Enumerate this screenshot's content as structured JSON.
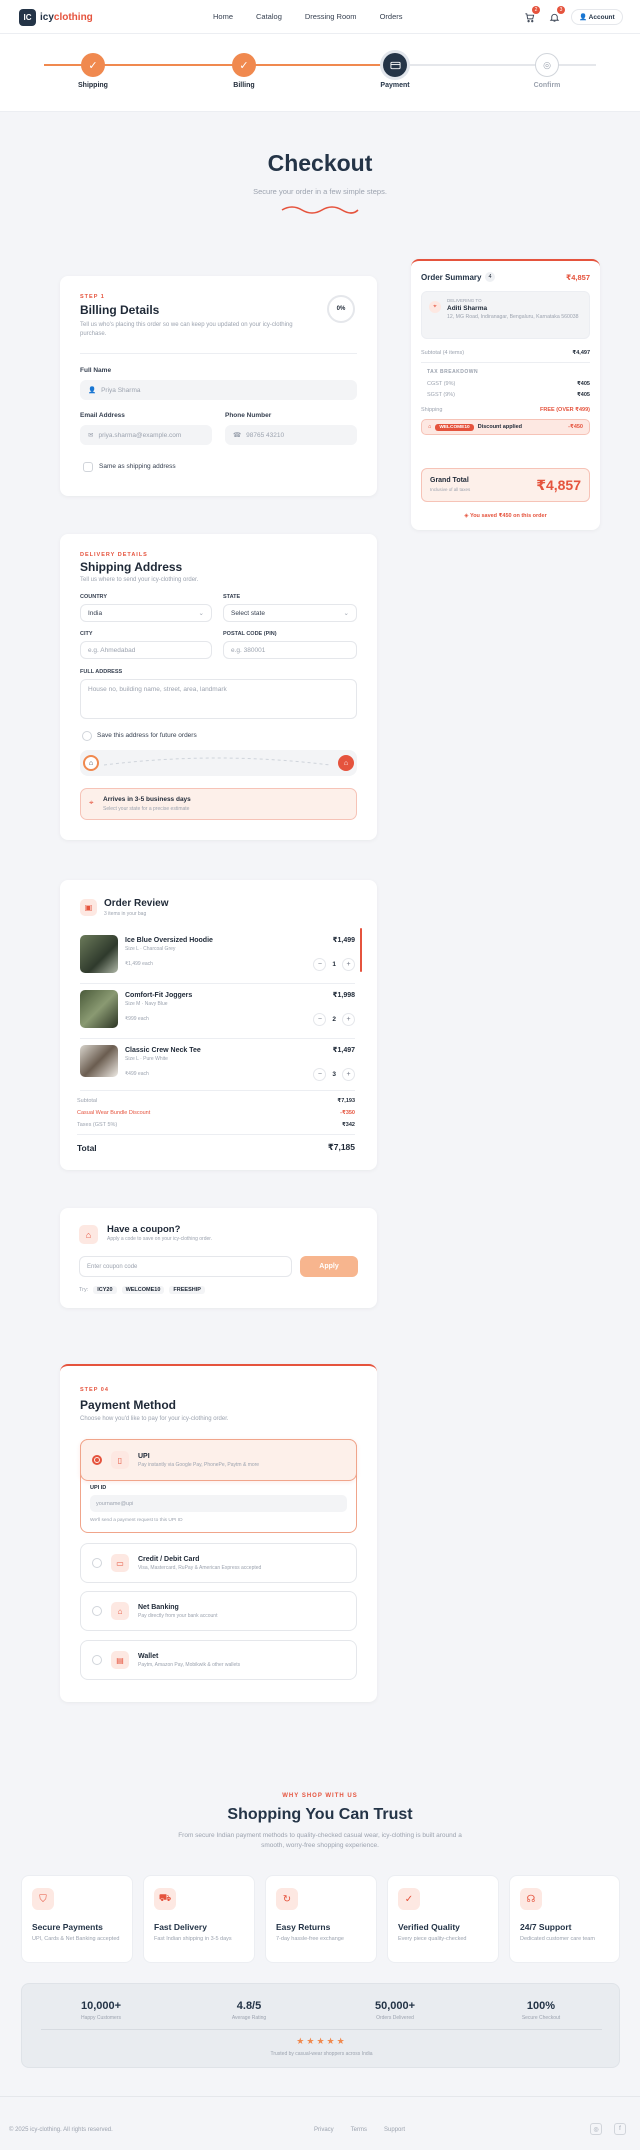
{
  "header": {
    "logo_mark": "IC",
    "brand_a": "icy",
    "brand_b": "clothing",
    "nav": [
      "Home",
      "Catalog",
      "Dressing Room",
      "Orders"
    ],
    "cart_count": "2",
    "notif_count": "3",
    "account_label": "Account"
  },
  "stepper": {
    "steps": [
      "Shipping",
      "Billing",
      "Payment",
      "Confirm"
    ]
  },
  "page": {
    "title": "Checkout",
    "subtitle": "Secure your order in a few simple steps."
  },
  "billing": {
    "eyebrow": "STEP 1",
    "title": "Billing Details",
    "subtitle": "Tell us who's placing this order so we can keep you updated on your icy-clothing purchase.",
    "progress": "0%",
    "progress_value": 0,
    "full_name_label": "Full Name",
    "full_name_placeholder": "Priya Sharma",
    "email_label": "Email Address",
    "email_placeholder": "priya.sharma@example.com",
    "phone_label": "Phone Number",
    "phone_placeholder": "98765 43210",
    "same_as_shipping": "Same as shipping address"
  },
  "summary": {
    "title": "Order Summary",
    "count": "4",
    "total_top": "₹4,857",
    "deliver_to_label": "DELIVERING TO",
    "name": "Aditi Sharma",
    "address": "12, MG Road, Indiranagar, Bengaluru, Karnataka 560038",
    "subtotal_label": "Subtotal (4 items)",
    "subtotal": "₹4,497",
    "tax_label": "TAX BREAKDOWN",
    "cgst_label": "CGST (9%)",
    "cgst": "₹405",
    "sgst_label": "SGST (9%)",
    "sgst": "₹405",
    "shipping_label": "Shipping",
    "shipping_value": "FREE (OVER ₹499)",
    "coupon_code": "WELCOME10",
    "discount_label": "Discount applied",
    "discount_value": "-₹450",
    "grand_label": "Grand Total",
    "grand_sub": "Inclusive of all taxes",
    "grand_value": "₹4,857",
    "saved": "You saved ₹450 on this order"
  },
  "shipping": {
    "eyebrow": "DELIVERY DETAILS",
    "title": "Shipping Address",
    "subtitle": "Tell us where to send your icy-clothing order.",
    "country_label": "COUNTRY",
    "country_value": "India",
    "state_label": "STATE",
    "state_value": "Select state",
    "city_label": "CITY",
    "city_placeholder": "e.g. Ahmedabad",
    "postal_label": "POSTAL CODE (PIN)",
    "postal_placeholder": "e.g. 380001",
    "address_label": "FULL ADDRESS",
    "address_placeholder": "House no, building name, street, area, landmark",
    "save_label": "Save this address for future orders",
    "eta_title": "Arrives in 3-5 business days",
    "eta_sub": "Select your state for a precise estimate"
  },
  "review": {
    "title": "Order Review",
    "subtitle": "3 items in your bag",
    "items": [
      {
        "name": "Ice Blue Oversized Hoodie",
        "meta": "Size L · Charcoal Grey",
        "unit": "₹1,499 each",
        "price": "₹1,499",
        "qty": "1"
      },
      {
        "name": "Comfort-Fit Joggers",
        "meta": "Size M · Navy Blue",
        "unit": "₹999 each",
        "price": "₹1,998",
        "qty": "2"
      },
      {
        "name": "Classic Crew Neck Tee",
        "meta": "Size L · Pure White",
        "unit": "₹499 each",
        "price": "₹1,497",
        "qty": "3"
      }
    ],
    "subtotal_label": "Subtotal",
    "subtotal": "₹7,193",
    "bundle_label": "Casual Wear Bundle Discount",
    "bundle": "-₹350",
    "taxes_label": "Taxes (GST 5%)",
    "taxes": "₹342",
    "total_label": "Total",
    "total": "₹7,185"
  },
  "coupon": {
    "title": "Have a coupon?",
    "subtitle": "Apply a code to save on your icy-clothing order.",
    "placeholder": "Enter coupon code",
    "apply": "Apply",
    "try_label": "Try:",
    "codes": [
      "ICY20",
      "WELCOME10",
      "FREESHIP"
    ]
  },
  "payment": {
    "eyebrow": "STEP 04",
    "title": "Payment Method",
    "subtitle": "Choose how you'd like to pay for your icy-clothing order.",
    "options": [
      {
        "title": "UPI",
        "desc": "Pay instantly via Google Pay, PhonePe, Paytm & more",
        "icon": "phone-icon"
      },
      {
        "title": "Credit / Debit Card",
        "desc": "Visa, Mastercard, RuPay & American Express accepted",
        "icon": "card-icon"
      },
      {
        "title": "Net Banking",
        "desc": "Pay directly from your bank account",
        "icon": "bank-icon"
      },
      {
        "title": "Wallet",
        "desc": "Paytm, Amazon Pay, Mobikwik & other wallets",
        "icon": "wallet-icon"
      }
    ],
    "upi_label": "UPI ID",
    "upi_placeholder": "yourname@upi",
    "upi_hint": "We'll send a payment request to this UPI ID"
  },
  "trust": {
    "eyebrow": "WHY SHOP WITH US",
    "title": "Shopping You Can Trust",
    "subtitle": "From secure Indian payment methods to quality-checked casual wear, icy-clothing is built around a smooth, worry-free shopping experience.",
    "features": [
      {
        "title": "Secure Payments",
        "desc": "UPI, Cards & Net Banking accepted",
        "icon": "shield-icon"
      },
      {
        "title": "Fast Delivery",
        "desc": "Fast Indian shipping in 3-5 days",
        "icon": "truck-icon"
      },
      {
        "title": "Easy Returns",
        "desc": "7-day hassle-free exchange",
        "icon": "refresh-icon"
      },
      {
        "title": "Verified Quality",
        "desc": "Every piece quality-checked",
        "icon": "check-shield-icon"
      },
      {
        "title": "24/7 Support",
        "desc": "Dedicated customer care team",
        "icon": "headset-icon"
      }
    ],
    "stats": [
      {
        "value": "10,000+",
        "label": "Happy Customers"
      },
      {
        "value": "4.8/5",
        "label": "Average Rating"
      },
      {
        "value": "50,000+",
        "label": "Orders Delivered"
      },
      {
        "value": "100%",
        "label": "Secure Checkout"
      }
    ],
    "stars": 5,
    "trusted": "Trusted by casual-wear shoppers across India"
  },
  "footer": {
    "copyright": "© 2025 icy-clothing. All rights reserved.",
    "links": [
      "Privacy",
      "Terms",
      "Support"
    ]
  },
  "colors": {
    "accent": "#e5533d",
    "navy": "#243447",
    "orange": "#f0894f"
  }
}
